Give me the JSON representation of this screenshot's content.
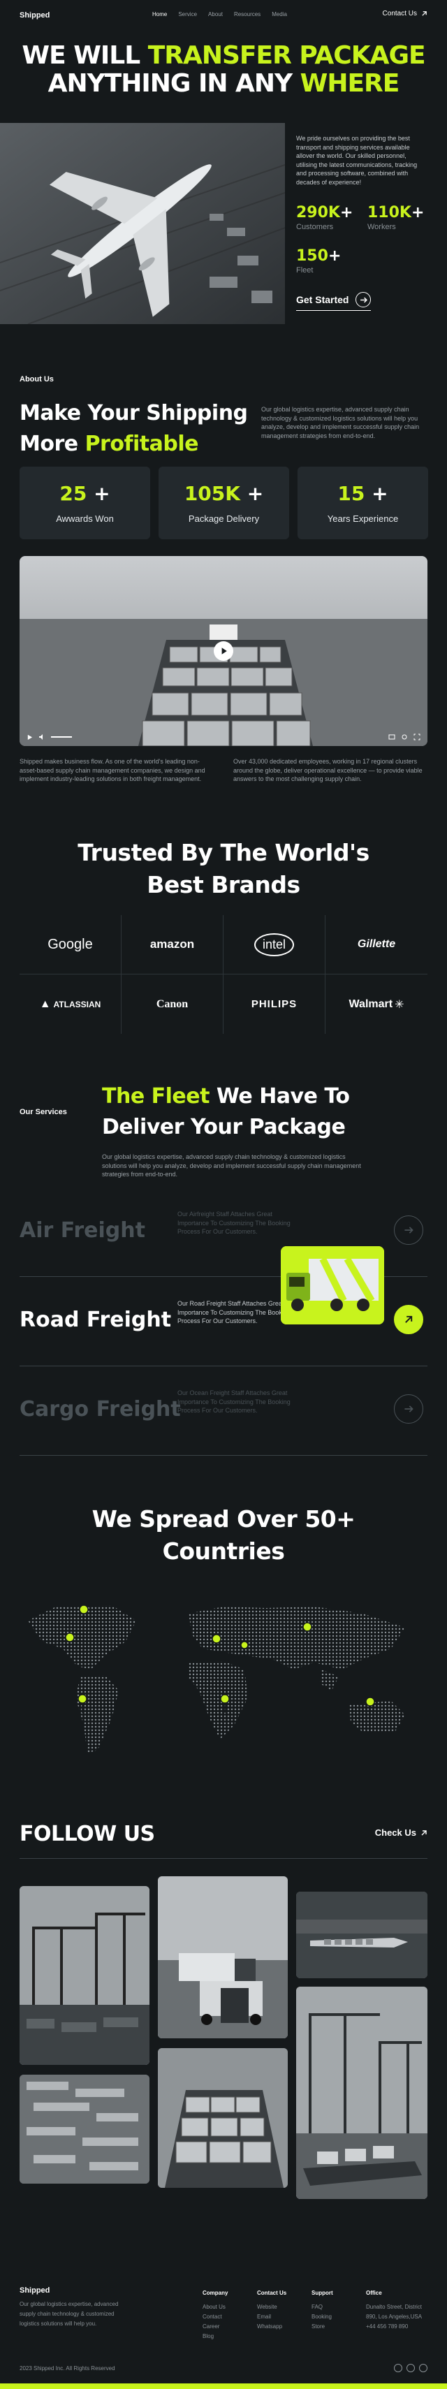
{
  "nav": {
    "logo": "Shipped",
    "links": [
      "Home",
      "Service",
      "About",
      "Resources",
      "Media"
    ],
    "contact": "Contact Us"
  },
  "hero": {
    "line1_white": "WE WILL ",
    "line1_lime": "TRANSFER PACKAGE",
    "line2_white": "ANYTHING IN ANY ",
    "line2_lime": "WHERE",
    "description": "We pride ourselves on providing the best transport and shipping services available allover the world. Our skilled personnel, utilising the latest communications, tracking and processing software, combined with decades of experience!",
    "stats": [
      {
        "value": "290K",
        "plus": "+",
        "label": "Customers"
      },
      {
        "value": "110K",
        "plus": "+",
        "label": "Workers"
      },
      {
        "value": "150",
        "plus": "+",
        "label": "Fleet"
      }
    ],
    "cta": "Get Started"
  },
  "about": {
    "label": "About Us",
    "title_white": "Make Your Shipping More ",
    "title_lime": "Profitable",
    "description": "Our global logistics expertise, advanced supply chain technology & customized logistics solutions will help you analyze, develop and implement successful supply chain management strategies from end-to-end.",
    "awards": [
      {
        "value": "25",
        "label": "Awwards Won"
      },
      {
        "value": "105K",
        "label": "Package Delivery"
      },
      {
        "value": "15",
        "label": "Years Experience"
      }
    ],
    "foot_left": "Shipped makes business flow. As one of the world's leading non-asset-based supply chain management companies, we design and implement industry-leading solutions in both freight management.",
    "foot_right": "Over 43,000 dedicated employees, working in 17 regional clusters around the globe, deliver operational excellence — to provide viable answers to the most challenging supply chain."
  },
  "brands": {
    "title_line1": "Trusted By The World's",
    "title_line2": "Best Brands",
    "items": [
      "Google",
      "amazon",
      "intel",
      "Gillette",
      "ATLASSIAN",
      "Canon",
      "PHILIPS",
      "Walmart"
    ]
  },
  "services": {
    "label": "Our Services",
    "title_lime": "The Fleet",
    "title_rest": " We Have To Deliver Your Package",
    "description": "Our global logistics expertise, advanced supply chain technology & customized logistics solutions will help you analyze, develop and implement successful supply chain management strategies from end-to-end.",
    "items": [
      {
        "name": "Air Freight",
        "text": "Our Airfreight Staff Attaches Great Importance To Customizing The Booking Process For Our Customers."
      },
      {
        "name": "Road Freight",
        "text": "Our Road Freight Staff Attaches Great Importance To Customizing The Booking Process For Our Customers."
      },
      {
        "name": "Cargo Freight",
        "text": "Our Ocean Freight Staff Attaches Great Importance To Customizing The Booking Process For Our Customers."
      }
    ]
  },
  "spread": {
    "title_line1": "We Spread Over 50+",
    "title_line2": "Countries"
  },
  "follow": {
    "title": "FOLLOW US",
    "link": "Check Us"
  },
  "footer": {
    "logo": "Shipped",
    "tagline": "Our global logistics expertise, advanced supply chain technology & customized logistics solutions will help you.",
    "company": {
      "title": "Company",
      "items": [
        "About Us",
        "Contact",
        "Career",
        "Blog"
      ]
    },
    "contact": {
      "title": "Contact Us",
      "items": [
        "Website",
        "Email",
        "Whatsapp"
      ]
    },
    "support": {
      "title": "Support",
      "items": [
        "FAQ",
        "Booking",
        "Store"
      ]
    },
    "office": {
      "title": "Office",
      "items": [
        "Dunalto Street, District 890, Los Angeles,USA",
        "+44 456 789 890"
      ]
    },
    "copyright": "2023 Shipped Inc. All Rights Reserved"
  },
  "colors": {
    "accent": "#c8f31d",
    "background": "#15191b",
    "card": "#23292d"
  }
}
